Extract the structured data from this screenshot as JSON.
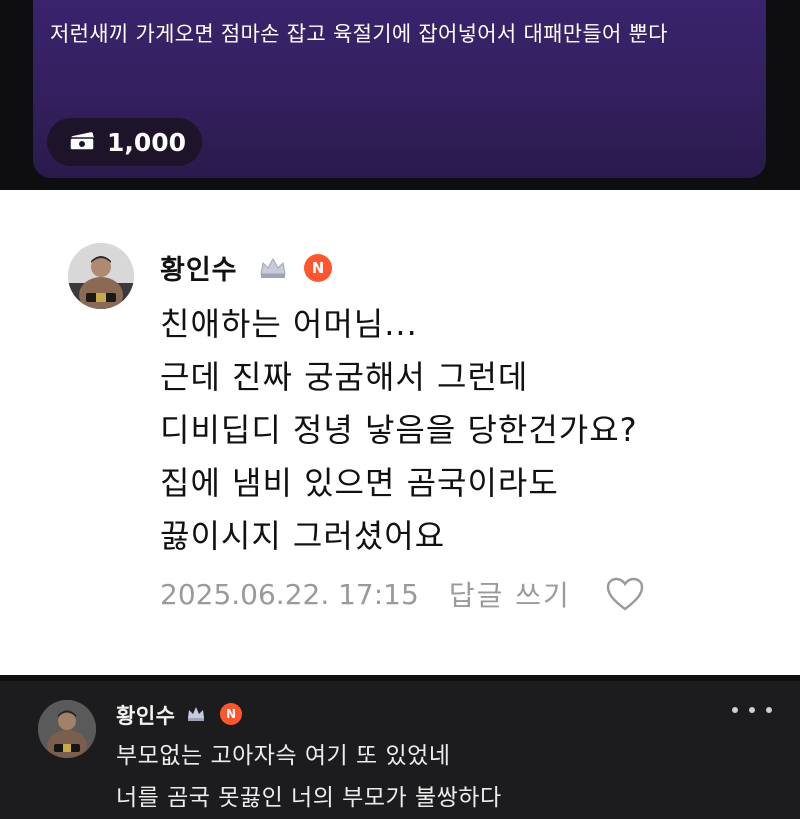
{
  "donation": {
    "message": "저런새끼 가게오면 점마손 잡고 육절기에 잡어넣어서 대패만들어 뿐다",
    "amount": "1,000",
    "amount_icon": "cash-icon",
    "card_color": "#34205f"
  },
  "comment": {
    "author": "황인수",
    "rank_icon": "crown-icon",
    "badge": "N",
    "lines": [
      "친애하는 어머님...",
      "근데 진짜 궁굼해서 그런데",
      "디비딥디 정녕 낳음을 당한건가요?",
      "집에 냄비 있으면 곰국이라도",
      "끓이시지 그러셨어요"
    ],
    "timestamp": "2025.06.22. 17:15",
    "reply_label": "답글 쓰기",
    "like_icon": "heart-icon"
  },
  "reply": {
    "author": "황인수",
    "rank_icon": "crown-icon",
    "badge": "N",
    "more_icon": "more-icon",
    "lines": [
      "부모없는 고아자슥 여기 또 있었네",
      "너를 곰국 못끓인 너의 부모가 불쌍하다"
    ]
  },
  "colors": {
    "badge": "#ff5630",
    "dark_bg": "#1c1c1e",
    "meta_text": "#9a9a9a"
  }
}
